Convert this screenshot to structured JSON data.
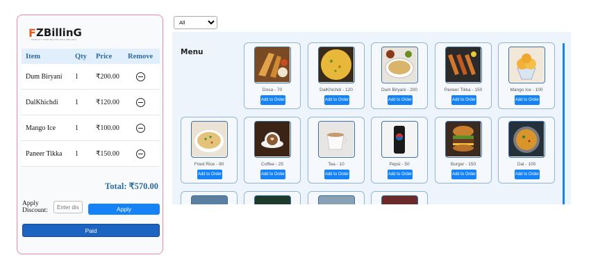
{
  "brand": {
    "mark": "F",
    "name": "ZBillinG",
    "tagline": "SIMPLIFY YOUR BILLING WITH ZBILLING"
  },
  "table": {
    "headers": [
      "Item",
      "Qty",
      "Price",
      "Remove"
    ],
    "rows": [
      {
        "item": "Dum Biryani",
        "qty": "1",
        "price": "₹200.00"
      },
      {
        "item": "DalKhichdi",
        "qty": "1",
        "price": "₹120.00"
      },
      {
        "item": "Mango Ice",
        "qty": "1",
        "price": "₹100.00"
      },
      {
        "item": "Paneer Tikka",
        "qty": "1",
        "price": "₹150.00"
      }
    ]
  },
  "total": "Total: ₹570.00",
  "discount": {
    "label": "Apply Discount:",
    "placeholder": "Enter discount",
    "apply_label": "Apply"
  },
  "paid_label": "Paid",
  "filter": {
    "selected": "All"
  },
  "menu": {
    "title": "Menu",
    "add_label": "Add to Order",
    "items": [
      {
        "name": "Dosa - 70",
        "icon": "dosa-image"
      },
      {
        "name": "DalKhichdi - 120",
        "icon": "dalkhichdi-image"
      },
      {
        "name": "Dum Biryani - 200",
        "icon": "biryani-image"
      },
      {
        "name": "Paneer Tikka - 150",
        "icon": "paneer-tikka-image"
      },
      {
        "name": "Mango Ice - 100",
        "icon": "mango-ice-image"
      },
      {
        "name": "Fried Rice - 80",
        "icon": "fried-rice-image"
      },
      {
        "name": "Coffee - 25",
        "icon": "coffee-image"
      },
      {
        "name": "Tea - 10",
        "icon": "tea-image"
      },
      {
        "name": "Pepsi - 50",
        "icon": "pepsi-image"
      },
      {
        "name": "Burger - 150",
        "icon": "burger-image"
      },
      {
        "name": "Dal - 100",
        "icon": "dal-image"
      }
    ]
  },
  "colors": {
    "accent": "#1583f5",
    "panel_border": "#e98aa6",
    "header_text": "#2c6ba0"
  }
}
